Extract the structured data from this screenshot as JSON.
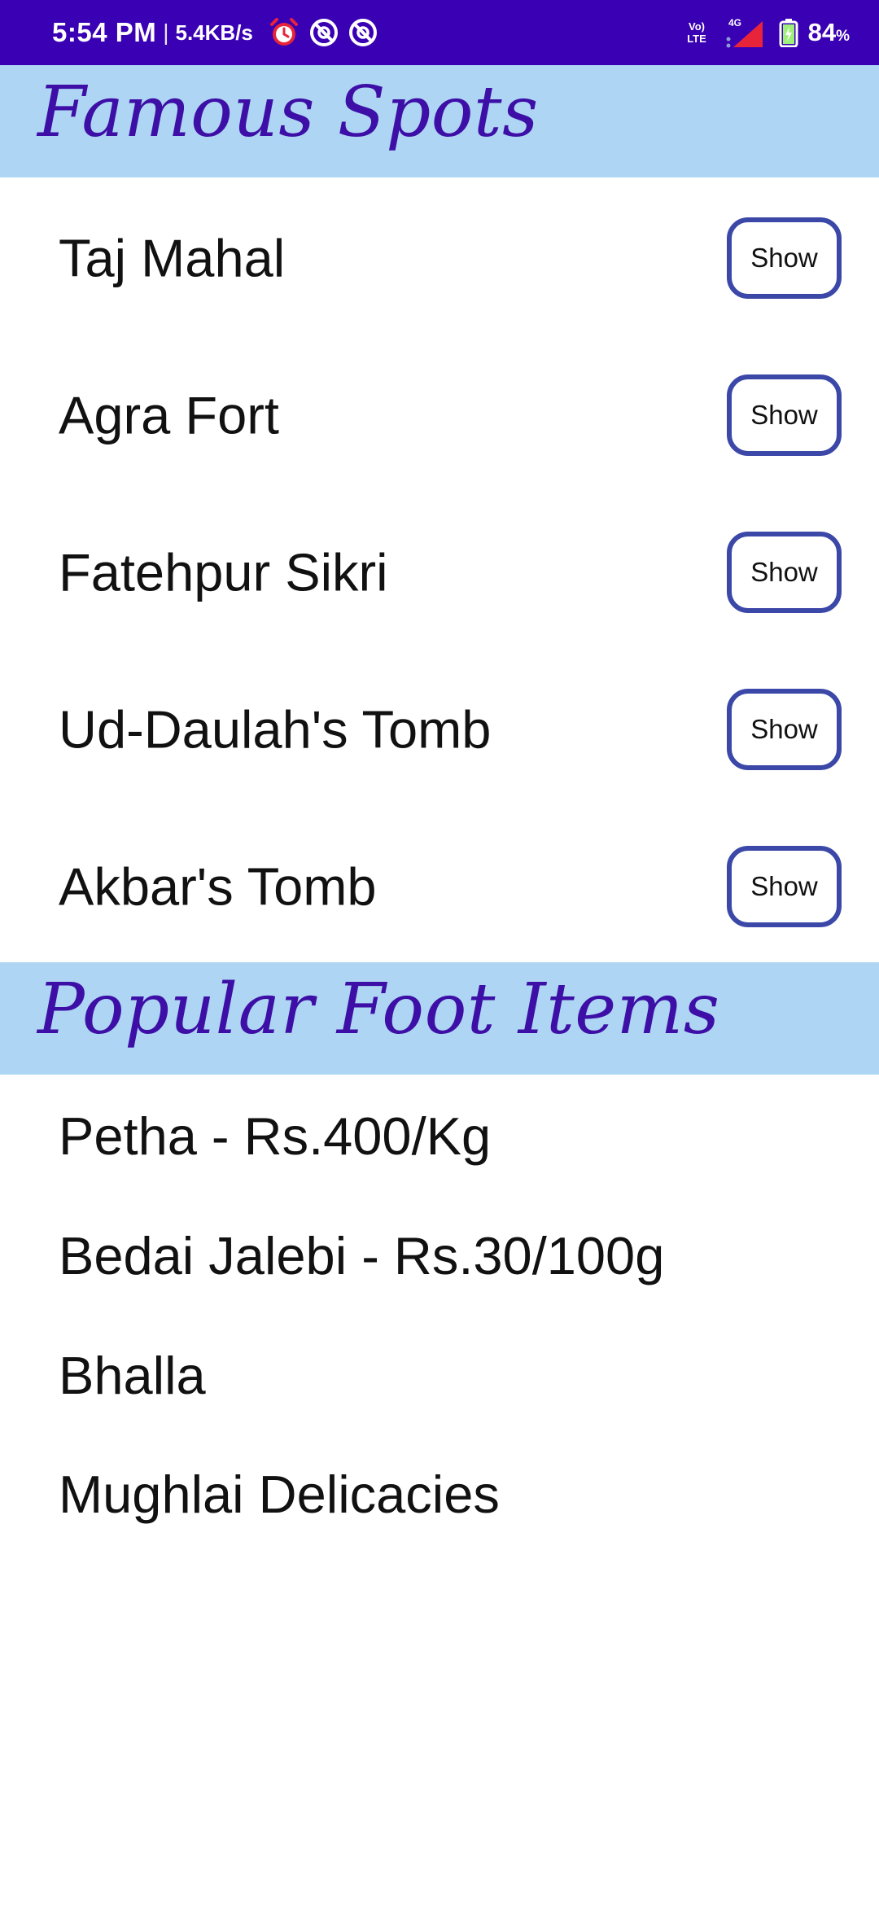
{
  "status_bar": {
    "time": "5:54 PM",
    "separator": "|",
    "net_speed": "5.4KB/s",
    "network_label": "4G",
    "volte_label": "Vo) LTE",
    "battery_percent": "84",
    "battery_unit": "%",
    "icons": [
      "alarm-icon",
      "sync-off-icon",
      "sync-off-icon",
      "volte-icon",
      "signal-icon",
      "battery-charging-icon"
    ],
    "bg_color": "#3a00b4"
  },
  "spots_section": {
    "title": "Famous Spots",
    "button_label": "Show",
    "items": [
      {
        "name": "Taj Mahal"
      },
      {
        "name": "Agra Fort"
      },
      {
        "name": "Fatehpur Sikri"
      },
      {
        "name": "Ud-Daulah's Tomb"
      },
      {
        "name": "Akbar's Tomb"
      }
    ]
  },
  "food_section": {
    "title": "Popular Foot Items",
    "items": [
      "Petha - Rs.400/Kg",
      "Bedai Jalebi - Rs.30/100g",
      "Bhalla",
      "Mughlai Delicacies"
    ]
  },
  "colors": {
    "header_bg": "#aed6f4",
    "header_text": "#3d0fa6",
    "button_border": "#3b48a8"
  }
}
